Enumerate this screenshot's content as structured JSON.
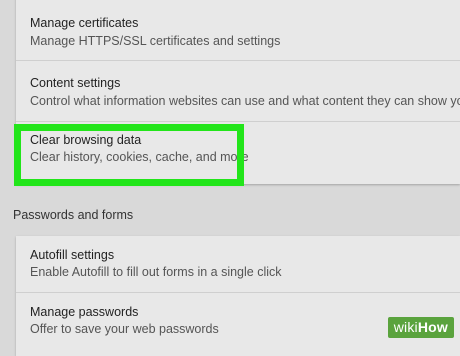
{
  "privacy": {
    "items": [
      {
        "title": "Manage certificates",
        "description": "Manage HTTPS/SSL certificates and settings"
      },
      {
        "title": "Content settings",
        "description": "Control what information websites can use and what content they can show you"
      },
      {
        "title": "Clear browsing data",
        "description": "Clear history, cookies, cache, and more"
      }
    ]
  },
  "passwords_and_forms": {
    "header": "Passwords and forms",
    "items": [
      {
        "title": "Autofill settings",
        "description": "Enable Autofill to fill out forms in a single click"
      },
      {
        "title": "Manage passwords",
        "description": "Offer to save your web passwords"
      }
    ]
  },
  "highlight_color": "#22e51a",
  "watermark": {
    "wiki": "wiki",
    "how": "How"
  }
}
